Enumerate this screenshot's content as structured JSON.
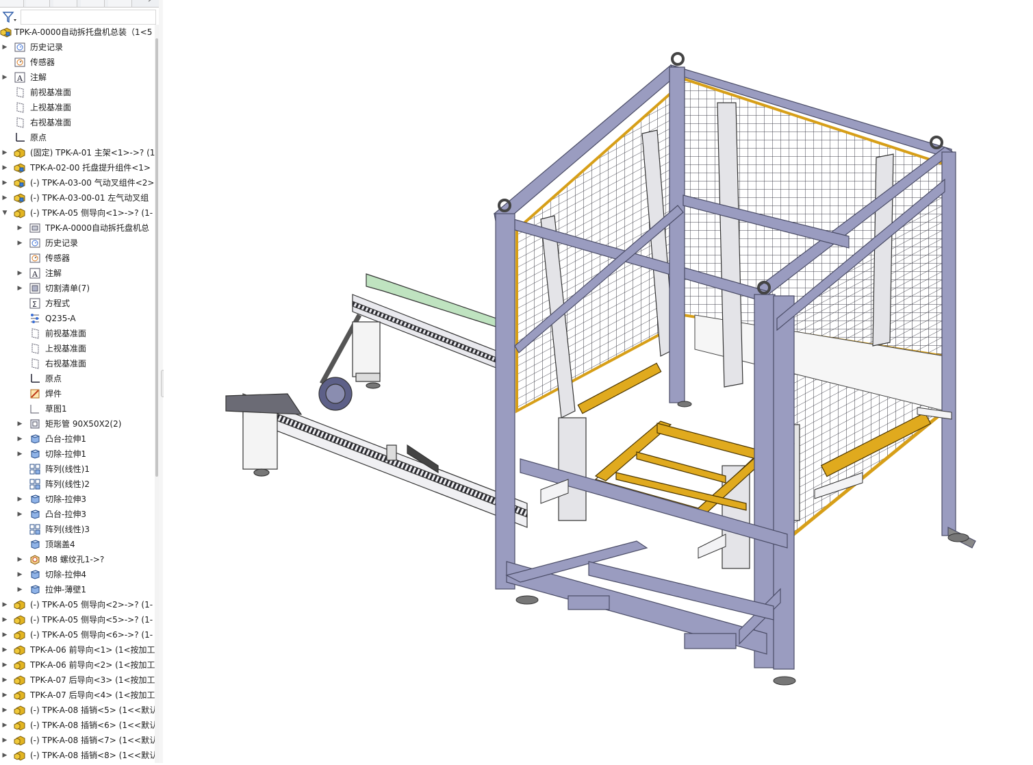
{
  "colors": {
    "frame": "#9a9cc0",
    "frame_edge": "#4a4c66",
    "yellow": "#e0aa1e",
    "mesh": "#3d3d48",
    "white_part": "#f2f2f2"
  },
  "tabs": [
    {
      "icon": "feature-manager-icon"
    },
    {
      "icon": "property-manager-icon"
    },
    {
      "icon": "configuration-manager-icon"
    },
    {
      "icon": "dimxpert-icon"
    },
    {
      "icon": "display-manager-icon"
    }
  ],
  "filter": {
    "icon": "filter-icon"
  },
  "tree": [
    {
      "level": 0,
      "expander": "",
      "icon": "assembly",
      "label": "TPK-A-0000自动拆托盘机总装（1<5"
    },
    {
      "level": 1,
      "expander": "▶",
      "icon": "history",
      "label": "历史记录"
    },
    {
      "level": 1,
      "expander": "",
      "icon": "sensor",
      "label": "传感器"
    },
    {
      "level": 1,
      "expander": "▶",
      "icon": "annotation",
      "label": "注解"
    },
    {
      "level": 1,
      "expander": "",
      "icon": "plane",
      "label": "前视基准面"
    },
    {
      "level": 1,
      "expander": "",
      "icon": "plane",
      "label": "上视基准面"
    },
    {
      "level": 1,
      "expander": "",
      "icon": "plane",
      "label": "右视基准面"
    },
    {
      "level": 1,
      "expander": "",
      "icon": "origin",
      "label": "原点"
    },
    {
      "level": 1,
      "expander": "▶",
      "icon": "subassembly",
      "label": "(固定) TPK-A-01 主架<1>->? (1"
    },
    {
      "level": 1,
      "expander": "▶",
      "icon": "assembly",
      "label": "TPK-A-02-00 托盘提升组件<1>"
    },
    {
      "level": 1,
      "expander": "▶",
      "icon": "assembly",
      "label": "(-) TPK-A-03-00 气动叉组件<2>"
    },
    {
      "level": 1,
      "expander": "▶",
      "icon": "assembly",
      "label": "(-) TPK-A-03-00-01 左气动叉组"
    },
    {
      "level": 1,
      "expander": "▼",
      "icon": "subassembly",
      "label": "(-) TPK-A-05 侧导向<1>->? (1-"
    },
    {
      "level": 2,
      "expander": "▶",
      "icon": "part-ref",
      "label": "TPK-A-0000自动拆托盘机总"
    },
    {
      "level": 2,
      "expander": "▶",
      "icon": "history",
      "label": "历史记录"
    },
    {
      "level": 2,
      "expander": "",
      "icon": "sensor",
      "label": "传感器"
    },
    {
      "level": 2,
      "expander": "▶",
      "icon": "annotation",
      "label": "注解"
    },
    {
      "level": 2,
      "expander": "▶",
      "icon": "cutlist",
      "label": "切割清单(7)"
    },
    {
      "level": 2,
      "expander": "",
      "icon": "equation",
      "label": "方程式"
    },
    {
      "level": 2,
      "expander": "",
      "icon": "material",
      "label": "Q235-A"
    },
    {
      "level": 2,
      "expander": "",
      "icon": "plane",
      "label": "前视基准面"
    },
    {
      "level": 2,
      "expander": "",
      "icon": "plane",
      "label": "上视基准面"
    },
    {
      "level": 2,
      "expander": "",
      "icon": "plane",
      "label": "右视基准面"
    },
    {
      "level": 2,
      "expander": "",
      "icon": "origin",
      "label": "原点"
    },
    {
      "level": 2,
      "expander": "",
      "icon": "weldment",
      "label": "焊件"
    },
    {
      "level": 2,
      "expander": "",
      "icon": "sketch",
      "label": "草图1"
    },
    {
      "level": 2,
      "expander": "▶",
      "icon": "structural",
      "label": "矩形管 90X50X2(2)"
    },
    {
      "level": 2,
      "expander": "▶",
      "icon": "feature",
      "label": "凸台-拉伸1"
    },
    {
      "level": 2,
      "expander": "▶",
      "icon": "feature",
      "label": "切除-拉伸1"
    },
    {
      "level": 2,
      "expander": "",
      "icon": "pattern",
      "label": "阵列(线性)1"
    },
    {
      "level": 2,
      "expander": "",
      "icon": "pattern",
      "label": "阵列(线性)2"
    },
    {
      "level": 2,
      "expander": "▶",
      "icon": "feature",
      "label": "切除-拉伸3"
    },
    {
      "level": 2,
      "expander": "▶",
      "icon": "feature",
      "label": "凸台-拉伸3"
    },
    {
      "level": 2,
      "expander": "",
      "icon": "pattern",
      "label": "阵列(线性)3"
    },
    {
      "level": 2,
      "expander": "",
      "icon": "feature",
      "label": "顶端盖4"
    },
    {
      "level": 2,
      "expander": "▶",
      "icon": "hole",
      "label": "M8 螺纹孔1->?"
    },
    {
      "level": 2,
      "expander": "▶",
      "icon": "feature",
      "label": "切除-拉伸4"
    },
    {
      "level": 2,
      "expander": "▶",
      "icon": "feature",
      "label": "拉伸-薄壁1"
    },
    {
      "level": 1,
      "expander": "▶",
      "icon": "subassembly",
      "label": "(-) TPK-A-05 侧导向<2>->? (1-"
    },
    {
      "level": 1,
      "expander": "▶",
      "icon": "subassembly",
      "label": "(-) TPK-A-05 侧导向<5>->? (1-"
    },
    {
      "level": 1,
      "expander": "▶",
      "icon": "subassembly",
      "label": "(-) TPK-A-05 侧导向<6>->? (1-"
    },
    {
      "level": 1,
      "expander": "▶",
      "icon": "subassembly",
      "label": "TPK-A-06 前导向<1> (1<按加工"
    },
    {
      "level": 1,
      "expander": "▶",
      "icon": "subassembly",
      "label": "TPK-A-06 前导向<2> (1<按加工"
    },
    {
      "level": 1,
      "expander": "▶",
      "icon": "subassembly",
      "label": "TPK-A-07 后导向<3> (1<按加工"
    },
    {
      "level": 1,
      "expander": "▶",
      "icon": "subassembly",
      "label": "TPK-A-07 后导向<4> (1<按加工"
    },
    {
      "level": 1,
      "expander": "▶",
      "icon": "subassembly",
      "label": "(-) TPK-A-08 插销<5> (1<<默认"
    },
    {
      "level": 1,
      "expander": "▶",
      "icon": "subassembly",
      "label": "(-) TPK-A-08 插销<6> (1<<默认"
    },
    {
      "level": 1,
      "expander": "▶",
      "icon": "subassembly",
      "label": "(-) TPK-A-08 插销<7> (1<<默认"
    },
    {
      "level": 1,
      "expander": "▶",
      "icon": "subassembly",
      "label": "(-) TPK-A-08 插销<8> (1<<默认"
    }
  ]
}
